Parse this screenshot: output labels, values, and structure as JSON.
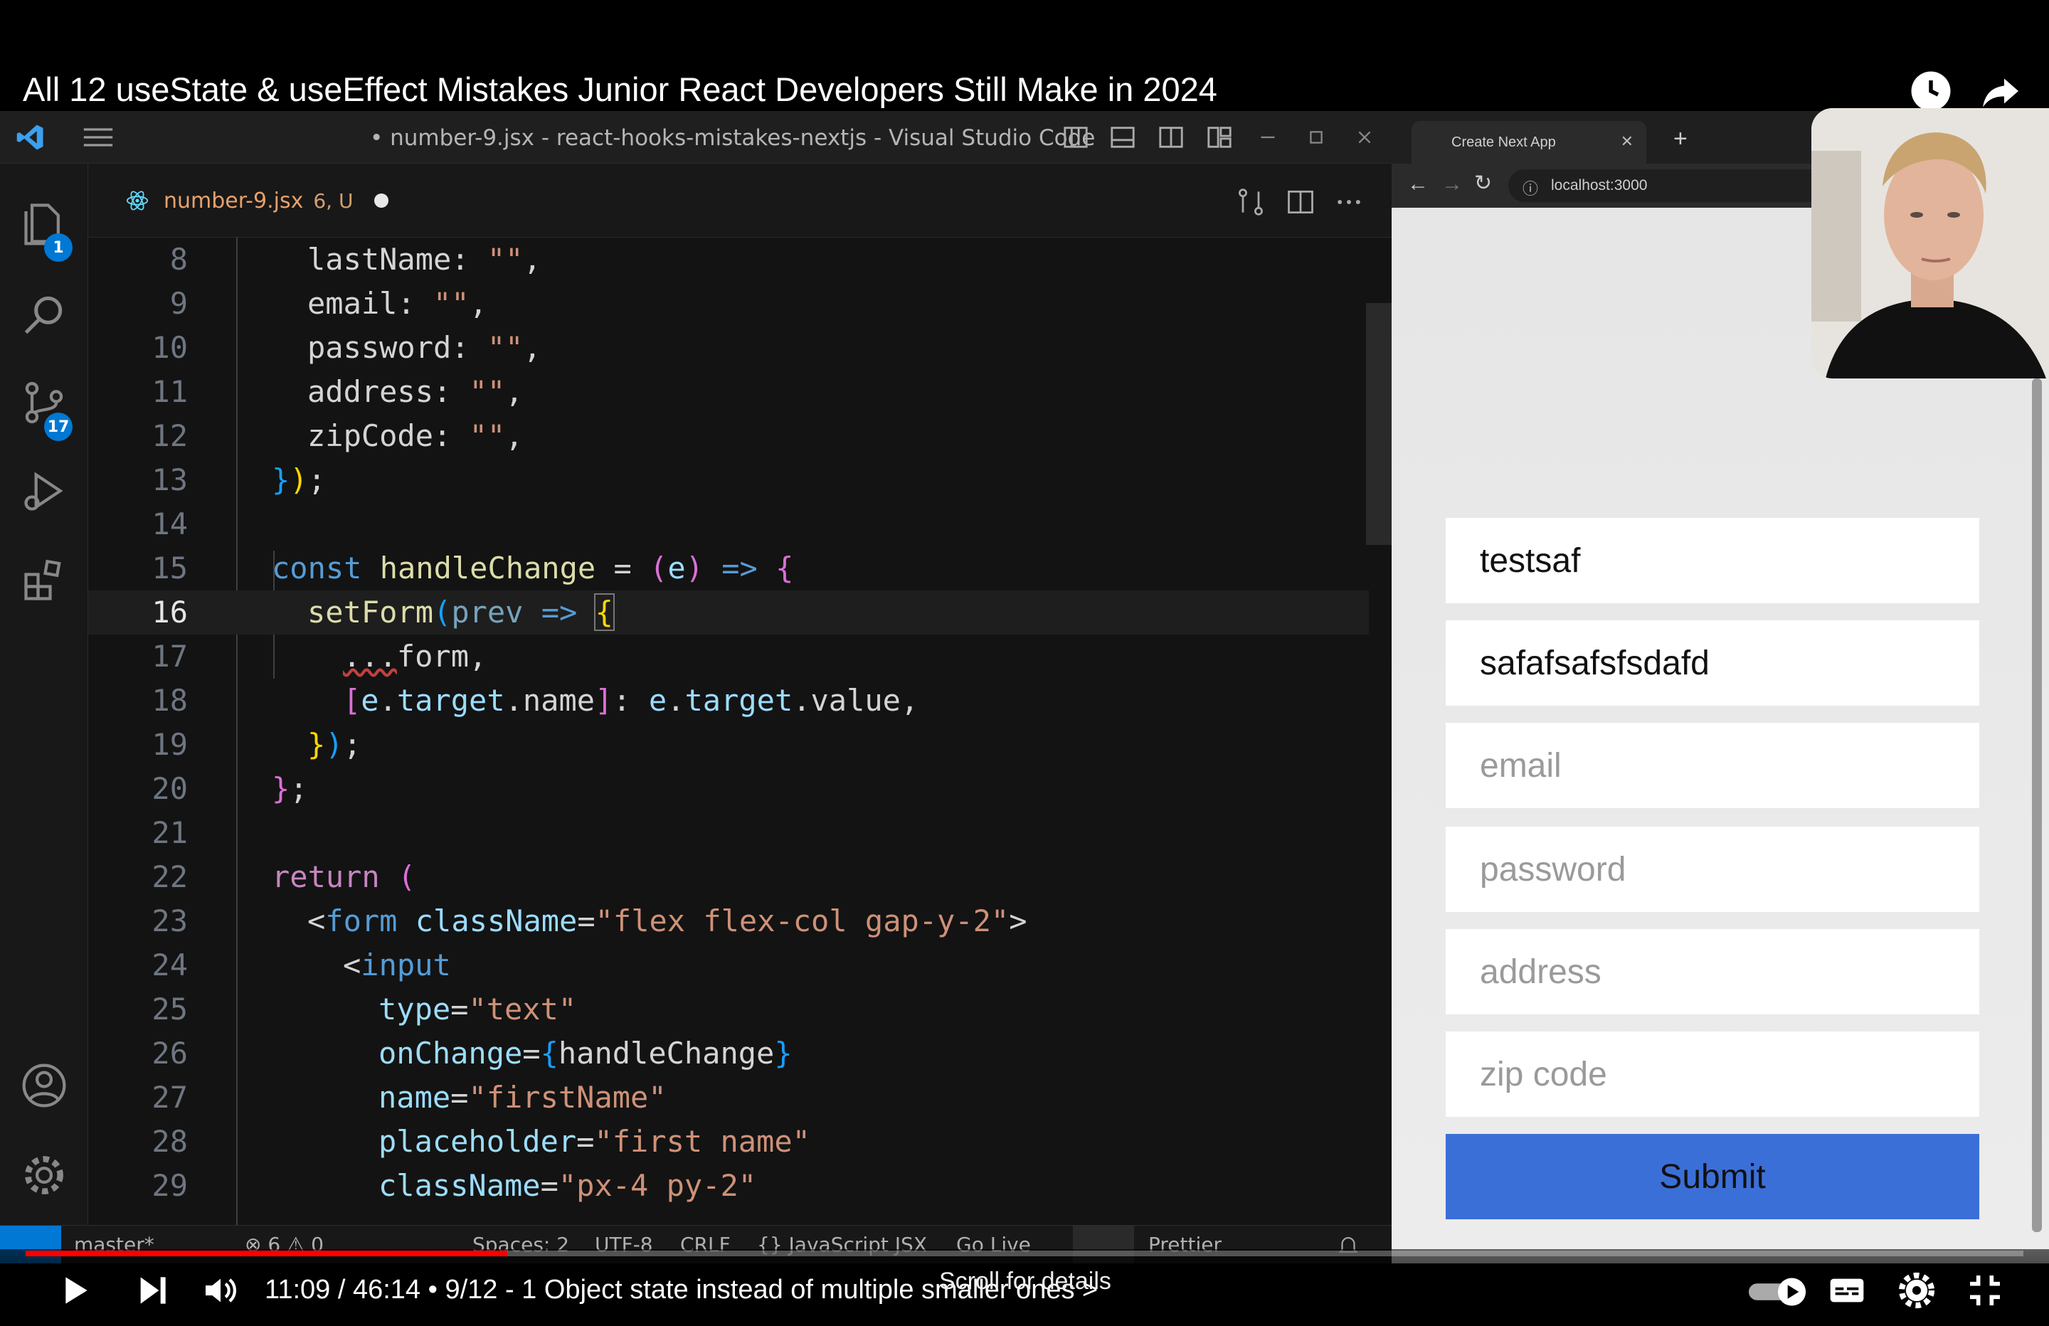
{
  "video": {
    "title": "All 12 useState & useEffect Mistakes Junior React Developers Still Make in 2024",
    "time": "11:09 / 46:14 • 9/12 - 1 Object state instead of multiple smaller ones >",
    "scroll_hint": "Scroll for details",
    "progress": 0.241,
    "icons": [
      "clock-icon",
      "share-icon",
      "play-icon",
      "next-icon",
      "volume-icon",
      "autoplay-toggle",
      "captions-icon",
      "settings-icon",
      "exit-fullscreen-icon"
    ]
  },
  "vscode": {
    "title": "• number-9.jsx - react-hooks-mistakes-nextjs - Visual Studio Code",
    "tab": {
      "label": "number-9.jsx",
      "meta": "6, U"
    },
    "badges": {
      "explorer": "1",
      "source_control": "17"
    },
    "status": {
      "branch": "master*",
      "errors": "⊗ 6 ⚠ 0",
      "spaces": "Spaces: 2",
      "encoding": "UTF-8",
      "eol": "CRLF",
      "language": "{} JavaScript JSX",
      "golive": "Go Live",
      "prettier": "Prettier"
    },
    "line_numbers": [
      "8",
      "9",
      "10",
      "11",
      "12",
      "13",
      "14",
      "15",
      "16",
      "17",
      "18",
      "19",
      "20",
      "21",
      "22",
      "23",
      "24",
      "25",
      "26",
      "27",
      "28",
      "29"
    ]
  },
  "browser": {
    "tab_title": "Create Next App",
    "url": "localhost:3000",
    "fields": [
      {
        "value": "testsaf",
        "kind": "value"
      },
      {
        "value": "safafsafsfsdafd",
        "kind": "value"
      },
      {
        "value": "email",
        "kind": "placeholder"
      },
      {
        "value": "password",
        "kind": "placeholder"
      },
      {
        "value": "address",
        "kind": "placeholder"
      },
      {
        "value": "zip code",
        "kind": "placeholder"
      }
    ],
    "submit_label": "Submit"
  },
  "colors": {
    "accent": "#3b6fd8",
    "progress": "#ff0000",
    "tab_label": "#e8a16b"
  }
}
